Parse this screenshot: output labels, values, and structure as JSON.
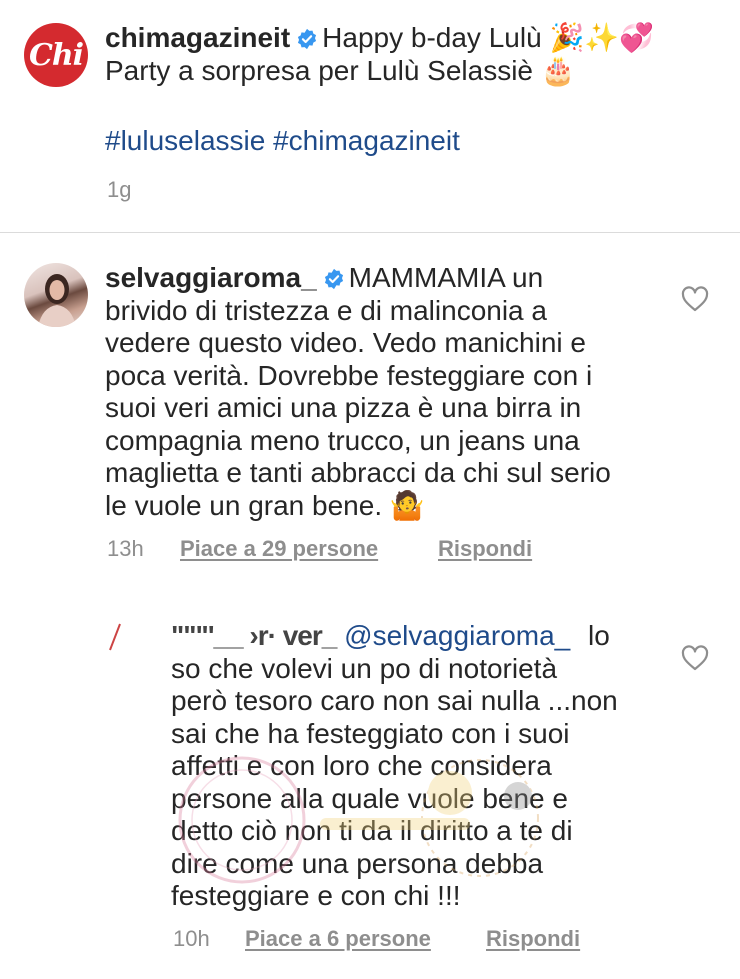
{
  "post": {
    "username": "chimagazineit",
    "caption_line1": "Happy b-day  Lulù",
    "caption_emoji1": "🎉✨💞",
    "caption_line2": "Party a sorpresa per Lulù Selassiè",
    "caption_emoji2": "🎂",
    "hashtags": [
      "#luluselassie",
      "#chimagazineit"
    ],
    "time": "1g",
    "logo_text": "Chi"
  },
  "comments": [
    {
      "username": "selvaggiaroma_",
      "first_line": "MAMMAMIA un",
      "lines": [
        "brivido di tristezza e di malinconia a",
        "vedere questo video. Vedo manichini e",
        "poca verità. Dovrebbe festeggiare con i",
        "suoi veri amici una pizza è una birra in",
        "compagnia meno trucco, un jeans una",
        "maglietta e tanti abbracci da chi sul serio",
        "le vuole un gran bene."
      ],
      "emoji": "🤷",
      "time": "13h",
      "likes": "Piace a 29 persone",
      "reply": "Rispondi"
    },
    {
      "username": "\"\"\"'__ ›r· ver_",
      "mention": "@selvaggiaroma_",
      "first_line_end": "lo",
      "lines": [
        "so che volevi un po di notorietà",
        "però tesoro caro non sai nulla ...non",
        "sai che ha festeggiato con i suoi",
        "affetti e con loro che considera",
        "persone alla quale vuole bene e",
        "detto ciò non ti da il diritto a te di",
        "dire come una persona debba",
        "festeggiare e con chi !!!"
      ],
      "time": "10h",
      "likes": "Piace a 6 persone",
      "reply": "Rispondi"
    }
  ],
  "colors": {
    "logo_red": "#d42a2f",
    "mention_blue": "#1f4b8a",
    "meta_gray": "#8e8e8e",
    "verified_blue": "#3897f0"
  }
}
